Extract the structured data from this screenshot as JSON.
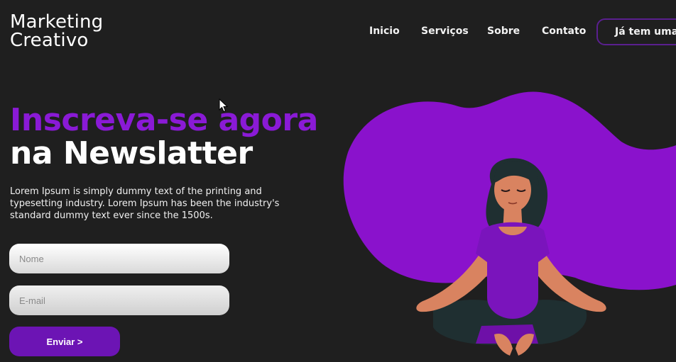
{
  "header": {
    "logo_line1": "Marketing",
    "logo_line2": "Creativo",
    "nav": [
      "Inicio",
      "Serviços",
      "Sobre",
      "Contato"
    ],
    "login_label": "Já tem uma"
  },
  "hero": {
    "headline_accent": "Inscreva-se agora",
    "headline_plain": "na Newslatter",
    "description": "Lorem Ipsum is simply dummy text of the printing and typesetting industry. Lorem Ipsum has been the industry's standard dummy text ever since the 1500s."
  },
  "form": {
    "name_placeholder": "Nome",
    "email_placeholder": "E-mail",
    "submit_label": "Enviar >"
  },
  "colors": {
    "background": "#1f1f1f",
    "accent": "#8a1ad6",
    "button": "#6c14b4",
    "blob": "#8a12cc"
  },
  "icons": [
    "mouse-pointer-icon"
  ]
}
